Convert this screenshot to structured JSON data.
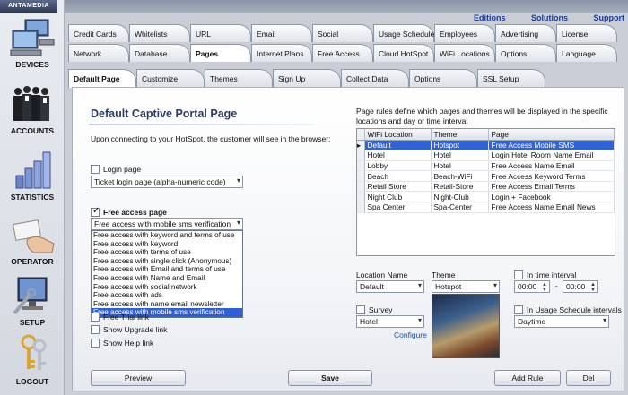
{
  "brand": "ANTAMEDIA",
  "sidebar": [
    {
      "label": "DEVICES",
      "icon": "computers-icon"
    },
    {
      "label": "ACCOUNTS",
      "icon": "people-icon"
    },
    {
      "label": "STATISTICS",
      "icon": "bar-chart-icon"
    },
    {
      "label": "OPERATOR",
      "icon": "hand-card-icon"
    },
    {
      "label": "SETUP",
      "icon": "monitor-wrench-icon"
    },
    {
      "label": "LOGOUT",
      "icon": "keys-icon"
    }
  ],
  "top_links": [
    "Editions",
    "Solutions",
    "Support"
  ],
  "tabs_row1": [
    "Credit Cards",
    "Whitelists",
    "URL",
    "Email",
    "Social",
    "Usage Schedule",
    "Employees",
    "Advertising",
    "License"
  ],
  "tabs_row2": [
    "Network",
    "Database",
    "Pages",
    "Internet Plans",
    "Free Access",
    "Cloud HotSpot",
    "WiFi Locations",
    "Options",
    "Language"
  ],
  "tabs_row3": [
    "Default Page",
    "Customize",
    "Themes",
    "Sign Up",
    "Collect Data",
    "Options",
    "SSL Setup"
  ],
  "left": {
    "title": "Default Captive Portal Page",
    "intro": "Upon connecting to your HotSpot, the customer will see in the browser:",
    "login_page_label": "Login page",
    "login_page_select": "Ticket login page (alpha-numeric code)",
    "free_access_label": "Free access page",
    "free_access_select": "Free access with mobile sms verification",
    "free_access_options": [
      "Free access with keyword and terms of use",
      "Free access with keyword",
      "Free access with terms of use",
      "Free access with single click (Anonymous)",
      "Free access with Email and terms of use",
      "Free access with Name and Email",
      "Free access with social network",
      "Free access with ads",
      "Free access with name email newsletter",
      "Free access with mobile sms verification"
    ],
    "free_trial_label": "Free Trial link",
    "upgrade_label": "Show Upgrade link",
    "help_label": "Show Help link"
  },
  "right": {
    "description": "Page rules define which pages and themes will be displayed in the specific locations and day or time interval",
    "columns": [
      "WiFi Location",
      "Theme",
      "Page"
    ],
    "rows": [
      [
        "Default",
        "Hotspot",
        "Free Access Mobile SMS"
      ],
      [
        "Hotel",
        "Hotel",
        "Login Hotel Room Name Email"
      ],
      [
        "Lobby",
        "Hotel",
        "Free Access Name Email"
      ],
      [
        "Beach",
        "Beach-WiFi",
        "Free Access Keyword Terms"
      ],
      [
        "Retail Store",
        "Retail-Store",
        "Free Access Email Terms"
      ],
      [
        "Night Club",
        "Night-Club",
        "Login + Facebook"
      ],
      [
        "Spa Center",
        "Spa-Center",
        "Free Access Name Email News"
      ]
    ],
    "location_label": "Location Name",
    "location_value": "Default",
    "theme_label": "Theme",
    "theme_value": "Hotspot",
    "time_label": "In time interval",
    "time_from": "00:00",
    "time_sep": "-",
    "time_to": "00:00",
    "survey_label": "Survey",
    "survey_value": "Hotel",
    "configure_label": "Configure",
    "usage_label": "In Usage Schedule intervals",
    "usage_value": "Daytime"
  },
  "buttons": {
    "preview": "Preview",
    "save": "Save",
    "add_rule": "Add Rule",
    "del": "Del"
  }
}
